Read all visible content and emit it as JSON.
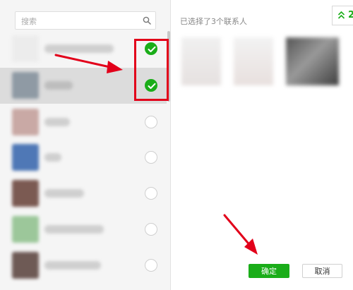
{
  "search": {
    "placeholder": "搜索",
    "icon": "search-icon"
  },
  "contacts": [
    {
      "selected": true,
      "highlighted": false
    },
    {
      "selected": true,
      "highlighted": true
    },
    {
      "selected": false,
      "highlighted": false
    },
    {
      "selected": false,
      "highlighted": false
    },
    {
      "selected": false,
      "highlighted": false
    },
    {
      "selected": false,
      "highlighted": false
    },
    {
      "selected": false,
      "highlighted": false
    }
  ],
  "selected_panel": {
    "count_text": "已选择了3个联系人",
    "collapse_icon": "chevron-double-up-icon",
    "collapse_badge": "2"
  },
  "buttons": {
    "confirm": "确定",
    "cancel": "取消"
  },
  "colors": {
    "accent": "#1aad19",
    "annotation": "#e2001a"
  }
}
